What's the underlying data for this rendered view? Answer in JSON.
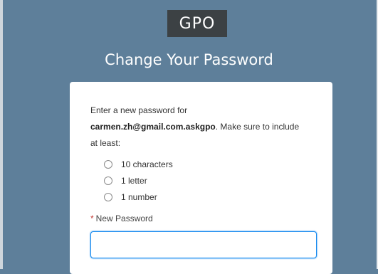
{
  "header": {
    "logo_text": "GPO",
    "title": "Change Your Password"
  },
  "card": {
    "intro_line1": "Enter a new password for",
    "email": "carmen.zh@gmail.com.askgpo",
    "intro_line2_rest": ". Make sure to include",
    "intro_line3": "at least:",
    "requirements": [
      {
        "label": "10 characters",
        "met": false
      },
      {
        "label": "1 letter",
        "met": false
      },
      {
        "label": "1 number",
        "met": false
      }
    ],
    "required_marker": "*",
    "new_password_label": "New Password",
    "new_password_value": ""
  },
  "colors": {
    "background": "#5e7f9a",
    "logo_bg": "#3c4144",
    "focus_border": "#1589ee",
    "required_star": "#c23934"
  }
}
